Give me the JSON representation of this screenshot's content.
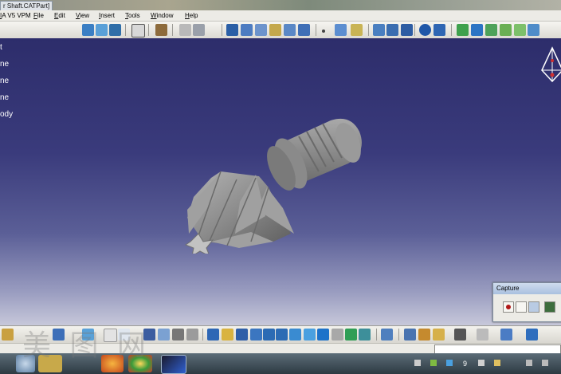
{
  "window": {
    "tab_title": "r Shaft.CATPart]",
    "app_name": "IA V5 VPM"
  },
  "menu": [
    "File",
    "Edit",
    "View",
    "Insert",
    "Tools",
    "Window",
    "Help"
  ],
  "tree": [
    "t",
    "ne",
    "ne",
    "ne",
    "ody"
  ],
  "capture_panel": {
    "title": "Capture"
  },
  "taskbar": {
    "tray_number": "9"
  },
  "watermark": "美 图 网",
  "colors": {
    "viewport_top": "#2d2d6b",
    "viewport_bottom": "#c7c8da",
    "part": "#8a8a8a"
  }
}
